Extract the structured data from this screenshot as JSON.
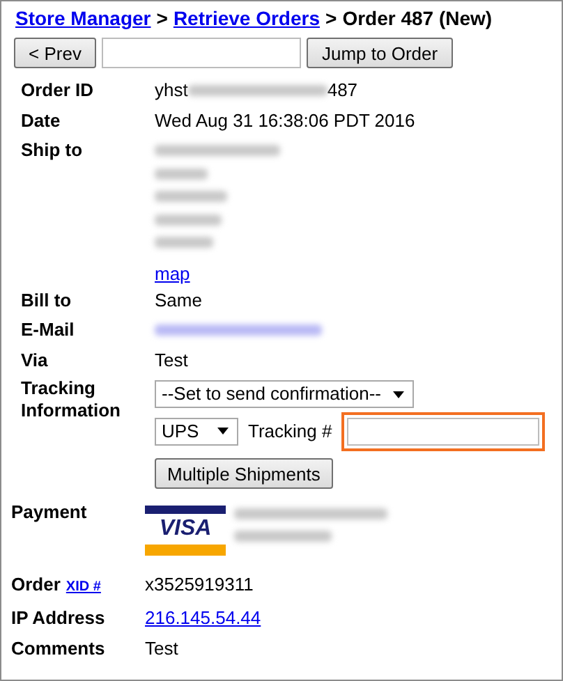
{
  "breadcrumb": {
    "links": [
      "Store Manager",
      "Retrieve Orders"
    ],
    "separator": ">",
    "current": "Order 487 (New)"
  },
  "nav": {
    "prev_button": "< Prev",
    "jump_button": "Jump to Order"
  },
  "details": [
    {
      "label": "Order ID",
      "kind": "order_id",
      "prefix": "yhst",
      "suffix": "487"
    },
    {
      "label": "Date",
      "kind": "text",
      "value": "Wed Aug 31 16:38:06 PDT 2016"
    },
    {
      "label": "Ship to",
      "kind": "address",
      "link": "map"
    },
    {
      "label": "Bill to",
      "kind": "text",
      "value": "Same"
    },
    {
      "label": "E-Mail",
      "kind": "email"
    },
    {
      "label": "Via",
      "kind": "text",
      "value": "Test"
    }
  ],
  "tracking": {
    "label": "Tracking Information",
    "status_select": "--Set to send confirmation--",
    "carrier_select": "UPS",
    "number_label": "Tracking #",
    "number_field": {
      "highlighted": true
    },
    "multiple_button": "Multiple Shipments"
  },
  "payment": {
    "label": "Payment",
    "card_brand": "VISA"
  },
  "extra": [
    {
      "label": "Order",
      "label_link": "XID #",
      "kind": "text",
      "value": "x3525919311"
    },
    {
      "label": "IP Address",
      "kind": "link",
      "value": "216.145.54.44"
    },
    {
      "label": "Comments",
      "kind": "text",
      "value": "Test"
    }
  ]
}
